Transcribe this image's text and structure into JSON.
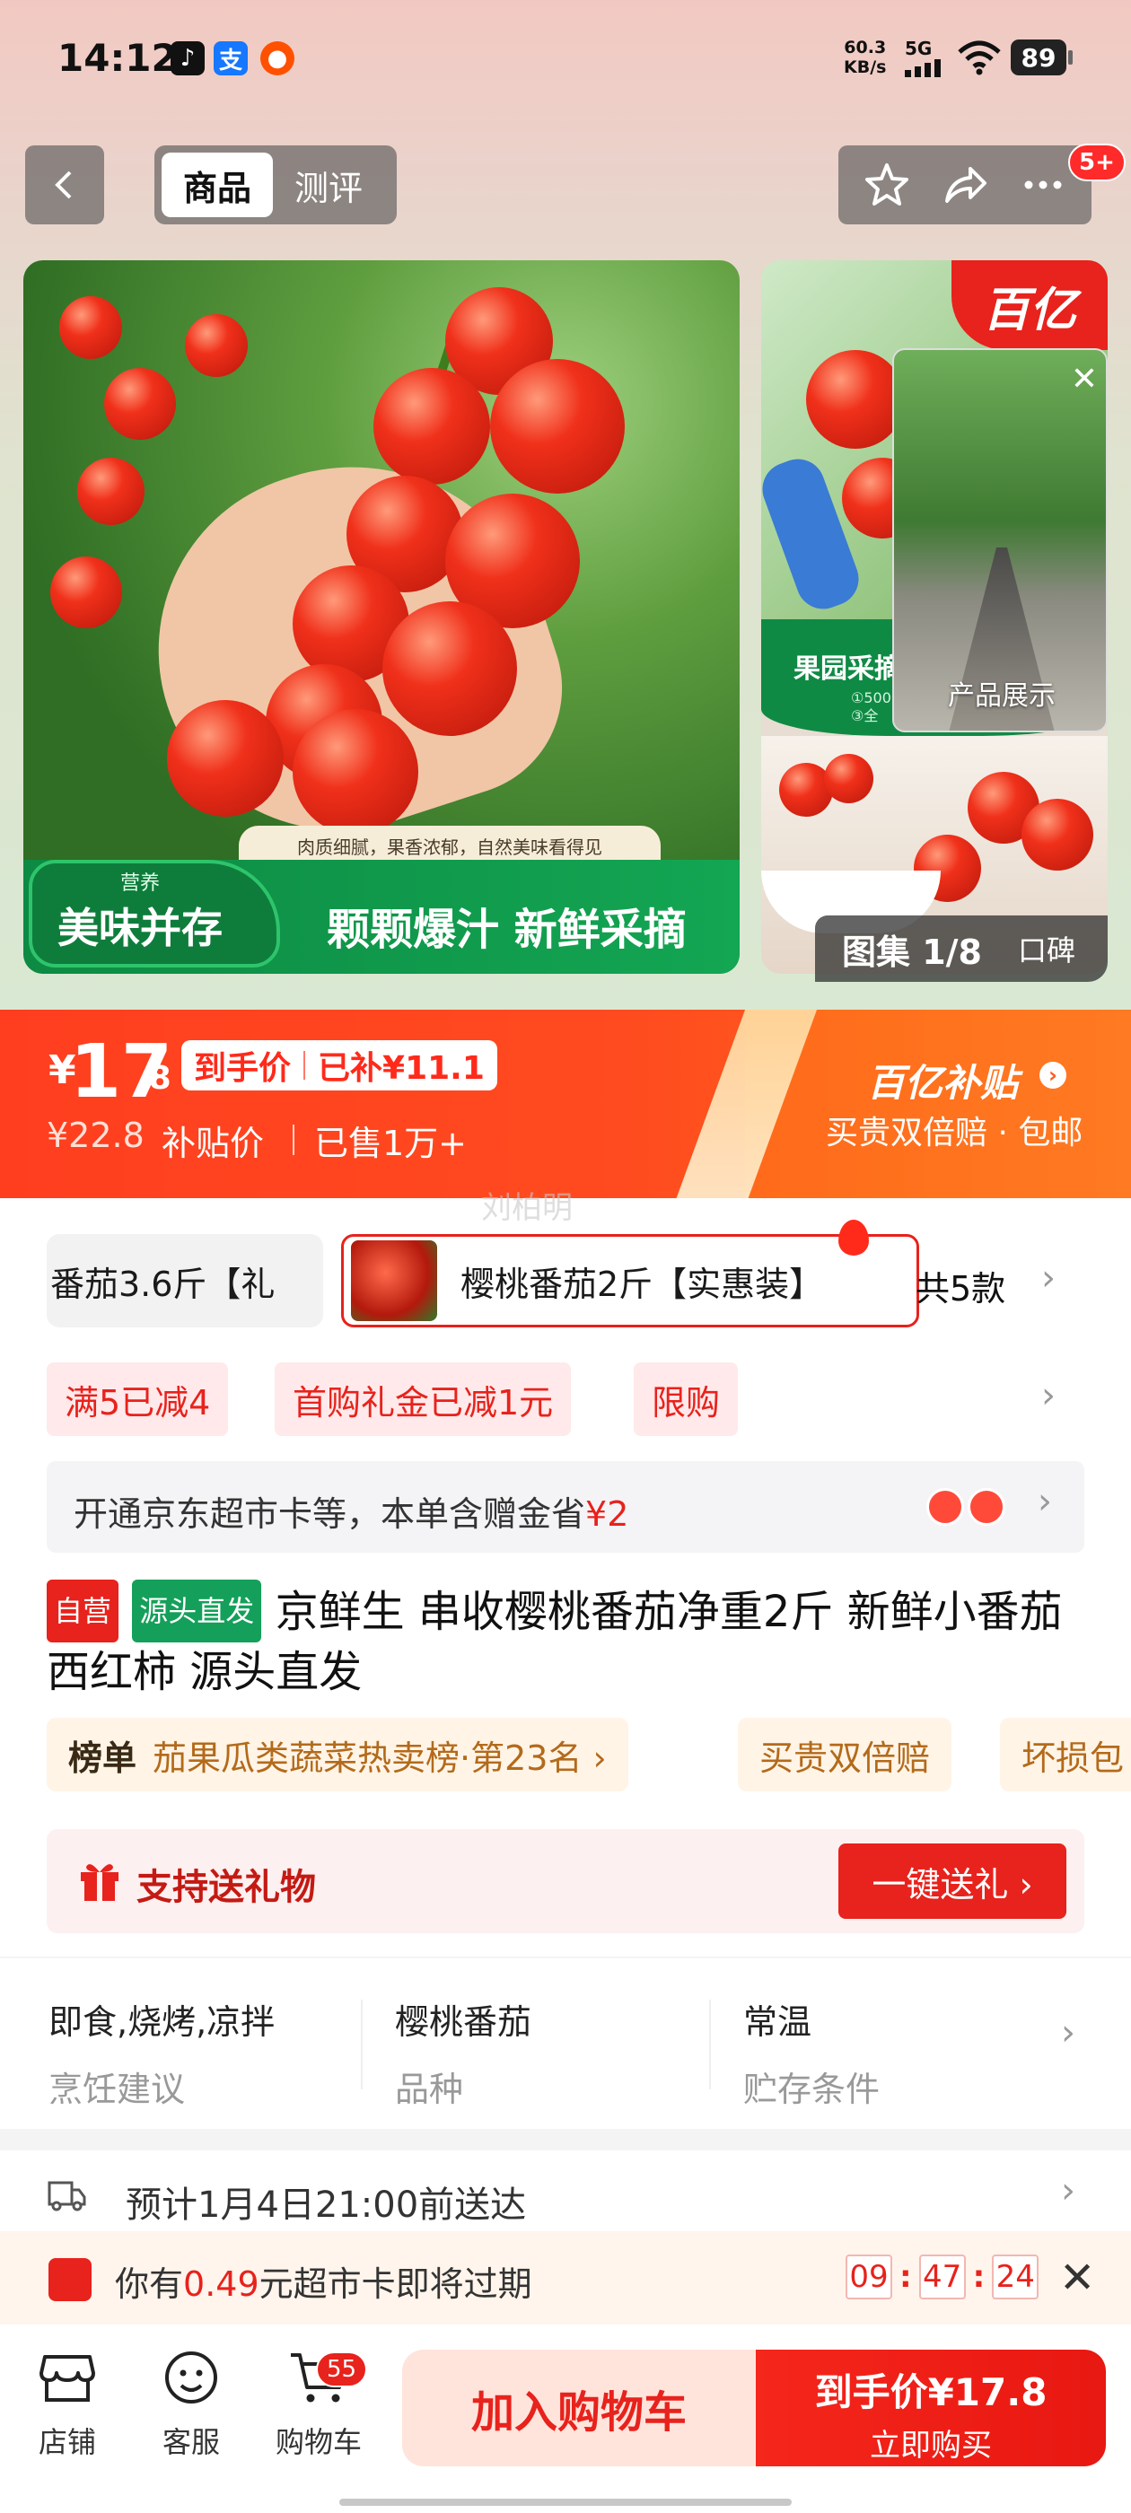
{
  "status_bar": {
    "time": "14:12",
    "net_speed_value": "60.3",
    "net_speed_unit": "KB/s",
    "network": "5G",
    "battery": "89"
  },
  "nav": {
    "tabs": [
      {
        "label": "商品"
      },
      {
        "label": "测评"
      }
    ],
    "more_badge": "5+"
  },
  "gallery": {
    "banner_strip": "肉质细腻，果香浓郁，自然美味看得见",
    "banner_small": "营养",
    "banner_left": "美味并存",
    "banner_right": "颗颗爆汁 新鲜采摘",
    "side_title": "果园采摘",
    "side_sub_1": "①500公",
    "side_sub_2": "③全",
    "video_label": "产品展示",
    "counter": "图集 1/8",
    "reviews_label": "口碑",
    "logo_text": "百亿"
  },
  "price": {
    "yen": "¥",
    "integer": "17",
    "decimal": ".8",
    "arrival_label": "到手价",
    "subsidized": "已补¥11.1",
    "original": "¥22.8",
    "subsidy_price_label": "补贴价",
    "sold": "已售1万+",
    "subsidy_brand": "百亿补贴",
    "subsidy_sub": "买贵双倍赔 · 包邮"
  },
  "watermark": "刘柏明",
  "variants": {
    "items": [
      {
        "label": "番茄3.6斤【礼"
      },
      {
        "label": "樱桃番茄2斤【实惠装】"
      }
    ],
    "count": "共5款"
  },
  "promos": [
    {
      "label": "满5已减4"
    },
    {
      "label": "首购礼金已减1元"
    },
    {
      "label": "限购"
    }
  ],
  "card_offer": {
    "text": "开通京东超市卡等，本单含赠金省",
    "amount": "¥2"
  },
  "product": {
    "tag_self": "自营",
    "tag_source": "源头直发",
    "title": "京鲜生 串收樱桃番茄净重2斤 新鲜小番茄西红柿 源头直发"
  },
  "ranking": {
    "label": "榜单",
    "value": "茄果瓜类蔬菜热卖榜·第23名 ›",
    "guarantee": "买贵双倍赔",
    "damage": "坏损包"
  },
  "gift": {
    "text": "支持送礼物",
    "button": "一键送礼 ›"
  },
  "attributes": [
    {
      "value": "即食,烧烤,凉拌",
      "key": "烹饪建议"
    },
    {
      "value": "樱桃番茄",
      "key": "品种"
    },
    {
      "value": "常温",
      "key": "贮存条件"
    }
  ],
  "delivery": {
    "text": "预计1月4日21:00前送达"
  },
  "expiry": {
    "prefix": "你有",
    "amount": "0.49",
    "suffix": "元超市卡即将过期",
    "h": "09",
    "m": "47",
    "s": "24"
  },
  "bottom": {
    "store": "店铺",
    "service": "客服",
    "cart": "购物车",
    "cart_count": "55",
    "add_cart": "加入购物车",
    "buy_price": "到手价¥17.8",
    "buy_now": "立即购买"
  },
  "colors": {
    "accent": "#e8221c",
    "price_bar": "#ff4b1f",
    "green": "#14a05a"
  }
}
